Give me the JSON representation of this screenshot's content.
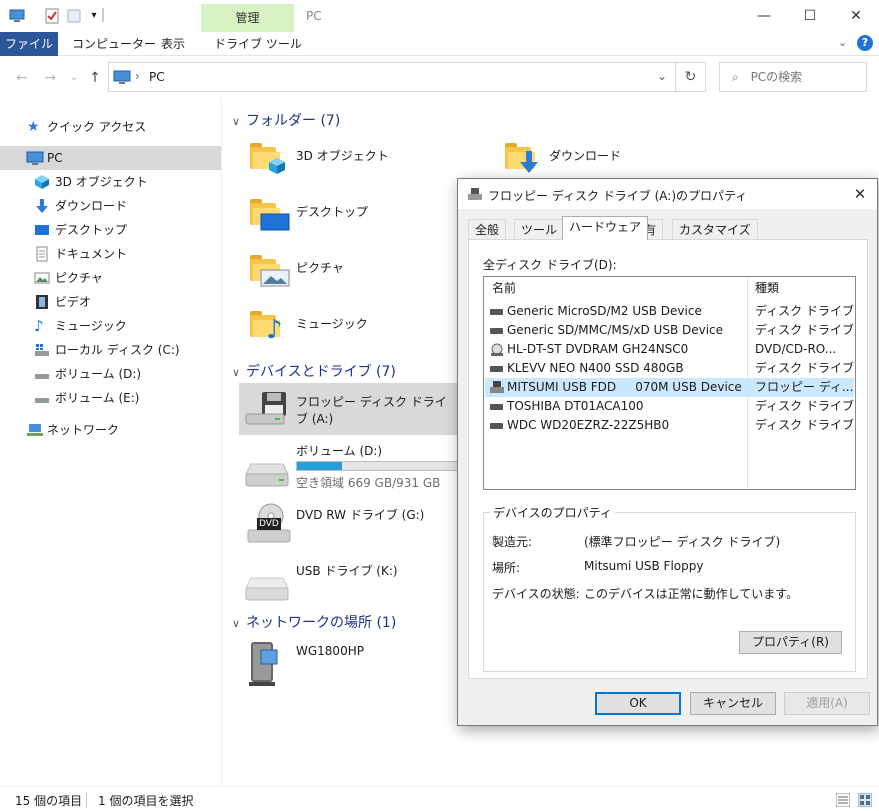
{
  "window": {
    "manage_tab": "管理",
    "title": "PC"
  },
  "ribbon": {
    "tabs": [
      "ファイル",
      "コンピューター",
      "表示",
      "ドライブ ツール"
    ]
  },
  "address": {
    "path_item": "PC",
    "search_placeholder": "PCの検索"
  },
  "sidebar": {
    "items": [
      {
        "label": "クイック アクセス",
        "icon": "star-icon"
      },
      {
        "label": "PC",
        "icon": "computer-icon"
      },
      {
        "label": "3D オブジェクト",
        "icon": "cube-icon"
      },
      {
        "label": "ダウンロード",
        "icon": "download-icon"
      },
      {
        "label": "デスクトップ",
        "icon": "desktop-icon"
      },
      {
        "label": "ドキュメント",
        "icon": "document-icon"
      },
      {
        "label": "ピクチャ",
        "icon": "picture-icon"
      },
      {
        "label": "ビデオ",
        "icon": "video-icon"
      },
      {
        "label": "ミュージック",
        "icon": "music-icon"
      },
      {
        "label": "ローカル ディスク (C:)",
        "icon": "windows-drive-icon"
      },
      {
        "label": "ボリューム (D:)",
        "icon": "drive-icon"
      },
      {
        "label": "ボリューム (E:)",
        "icon": "drive-icon"
      },
      {
        "label": "ネットワーク",
        "icon": "network-icon"
      }
    ]
  },
  "main": {
    "folders_header": "フォルダー (7)",
    "folders": [
      "3D オブジェクト",
      "ダウンロード",
      "デスクトップ",
      "ピクチャ",
      "ミュージック"
    ],
    "devices_header": "デバイスとドライブ (7)",
    "devices": {
      "floppy": "フロッピー ディスク ドライブ (A:)",
      "volume_d": "ボリューム (D:)",
      "volume_d_free": "空き領域 669 GB/931 GB",
      "volume_d_used_fraction": 0.28,
      "dvd": "DVD RW ドライブ (G:)",
      "dvd_badge": "DVD",
      "usb": "USB ドライブ (K:)"
    },
    "network_header": "ネットワークの場所 (1)",
    "network_items": [
      "WG1800HP"
    ]
  },
  "status": {
    "count": "15 個の項目",
    "selected": "1 個の項目を選択"
  },
  "dialog": {
    "title": "フロッピー ディスク ドライブ (A:)のプロパティ",
    "tabs": [
      "全般",
      "ツール",
      "ハードウェア",
      "共有",
      "カスタマイズ"
    ],
    "active_tab": "ハードウェア",
    "list_label": "全ディスク ドライブ(D):",
    "columns": [
      "名前",
      "種類"
    ],
    "rows": [
      {
        "name": "Generic MicroSD/M2 USB Device",
        "type": "ディスク ドライブ"
      },
      {
        "name": "Generic SD/MMC/MS/xD USB Device",
        "type": "ディスク ドライブ"
      },
      {
        "name": "HL-DT-ST DVDRAM GH24NSC0",
        "type": "DVD/CD-RO..."
      },
      {
        "name": "KLEVV NEO N400 SSD 480GB",
        "type": "ディスク ドライブ"
      },
      {
        "name": "MITSUMI USB FDD     070M USB Device",
        "type": "フロッピー ディ..."
      },
      {
        "name": "TOSHIBA DT01ACA100",
        "type": "ディスク ドライブ"
      },
      {
        "name": "WDC WD20EZRZ-22Z5HB0",
        "type": "ディスク ドライブ"
      }
    ],
    "selected_row": 4,
    "props_legend": "デバイスのプロパティ",
    "props": [
      {
        "key": "製造元:",
        "value": "(標準フロッピー ディスク ドライブ)"
      },
      {
        "key": "場所:",
        "value": "Mitsumi USB Floppy"
      },
      {
        "key": "デバイスの状態:",
        "value": "このデバイスは正常に動作しています。"
      }
    ],
    "properties_button": "プロパティ(R)",
    "ok_button": "OK",
    "cancel_button": "キャンセル",
    "apply_button": "適用(A)"
  },
  "colors": {
    "accent": "#2b579a",
    "selection": "#cce8ff",
    "manage_tab_bg": "#d9f2c4",
    "progress": "#26a0da"
  }
}
